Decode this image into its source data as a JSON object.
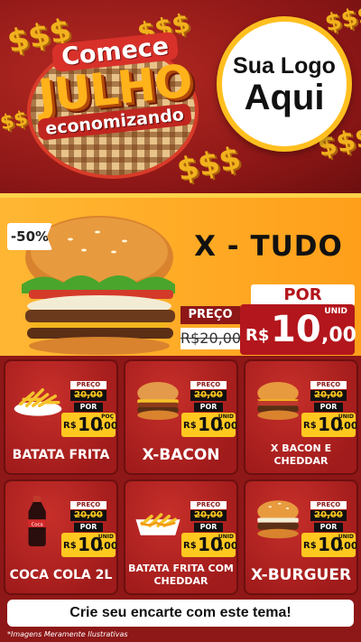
{
  "header": {
    "title_line1": "Comece",
    "title_line2": "JULHO",
    "title_line3": "economizando",
    "dollar_sign": "$$$",
    "logo_line1": "Sua Logo",
    "logo_line2": "Aqui"
  },
  "featured": {
    "discount": "-50%",
    "name": "X - TUDO",
    "price_label": "PREÇO",
    "old_price": "R$20,00",
    "por_label": "POR",
    "unit_label": "UNID",
    "currency": "R$",
    "price_int": "10",
    "price_dec": ",00"
  },
  "products": [
    {
      "name": "BATATA FRITA",
      "preco": "PREÇO",
      "old": "20,00",
      "por": "POR",
      "currency": "R$",
      "int": "10",
      "dec": ",00",
      "unit": "POÇ",
      "icon": "fries-plate-icon"
    },
    {
      "name": "X-BACON",
      "preco": "PREÇO",
      "old": "20,00",
      "por": "POR",
      "currency": "R$",
      "int": "10",
      "dec": ",00",
      "unit": "UNID",
      "icon": "bacon-burger-icon"
    },
    {
      "name": "X BACON E CHEDDAR",
      "preco": "PREÇO",
      "old": "20,00",
      "por": "POR",
      "currency": "R$",
      "int": "10",
      "dec": ",00",
      "unit": "UNID",
      "icon": "cheddar-burger-icon"
    },
    {
      "name": "COCA COLA 2L",
      "preco": "PREÇO",
      "old": "20,00",
      "por": "POR",
      "currency": "R$",
      "int": "10",
      "dec": ",00",
      "unit": "UNID",
      "icon": "cola-bottle-icon"
    },
    {
      "name": "BATATA FRITA COM CHEDDAR",
      "preco": "PREÇO",
      "old": "20,00",
      "por": "POR",
      "currency": "R$",
      "int": "10",
      "dec": ",00",
      "unit": "UNID",
      "icon": "cheddar-fries-icon"
    },
    {
      "name": "X-BURGUER",
      "preco": "PREÇO",
      "old": "20,00",
      "por": "POR",
      "currency": "R$",
      "int": "10",
      "dec": ",00",
      "unit": "UNID",
      "icon": "burger-icon"
    }
  ],
  "footer": {
    "cta": "Crie seu encarte com este tema!",
    "disclaimer": "*Imagens Meramente Ilustrativas"
  },
  "colors": {
    "background": "#8e1717",
    "accent_orange": "#ffa726",
    "price_yellow": "#ffc81f",
    "price_red": "#b3161c"
  }
}
